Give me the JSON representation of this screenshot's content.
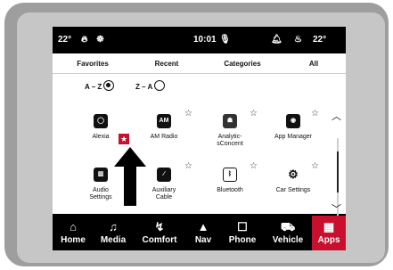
{
  "status": {
    "temp_left": "22°",
    "time": "10:01",
    "temp_right": "22°"
  },
  "tabs": [
    "Favorites",
    "Recent",
    "Categories",
    "All"
  ],
  "sort": {
    "az": "A – Z",
    "za": "Z – A",
    "selected": "A – Z"
  },
  "apps": [
    {
      "name": "Alexia",
      "icon": "alexa-icon",
      "glyph": "◯"
    },
    {
      "name": "AM Radio",
      "icon": "am-radio-icon",
      "glyph": "AM"
    },
    {
      "name": "Analytic-\nsConcent",
      "icon": "android-icon",
      "glyph": "☗"
    },
    {
      "name": "App Manager",
      "icon": "app-manager-icon",
      "glyph": "◉"
    },
    {
      "name": "Audio\nSettings",
      "icon": "audio-icon",
      "glyph": "▥"
    },
    {
      "name": "Auxiliary\nCable",
      "icon": "aux-cable-icon",
      "glyph": "∕"
    },
    {
      "name": "Bluetooth",
      "icon": "bluetooth-icon",
      "glyph": "ᛒ"
    },
    {
      "name": "Car Settings",
      "icon": "car-settings-icon",
      "glyph": "⚙"
    }
  ],
  "favorite_mark": "★",
  "nav": [
    {
      "label": "Home",
      "icon": "home-icon",
      "glyph": "⌂"
    },
    {
      "label": "Media",
      "icon": "music-note-icon",
      "glyph": "♫"
    },
    {
      "label": "Comfort",
      "icon": "seat-heat-icon",
      "glyph": "↯"
    },
    {
      "label": "Nav",
      "icon": "nav-arrow-icon",
      "glyph": "▲"
    },
    {
      "label": "Phone",
      "icon": "phone-icon",
      "glyph": "☐"
    },
    {
      "label": "Vehicle",
      "icon": "vehicle-icon",
      "glyph": "⛟"
    },
    {
      "label": "Apps",
      "icon": "apps-grid-icon",
      "glyph": "▦",
      "active": true
    }
  ],
  "colors": {
    "accent": "#c8102e",
    "screen_bg": "#000000",
    "content_bg": "#ffffff"
  }
}
